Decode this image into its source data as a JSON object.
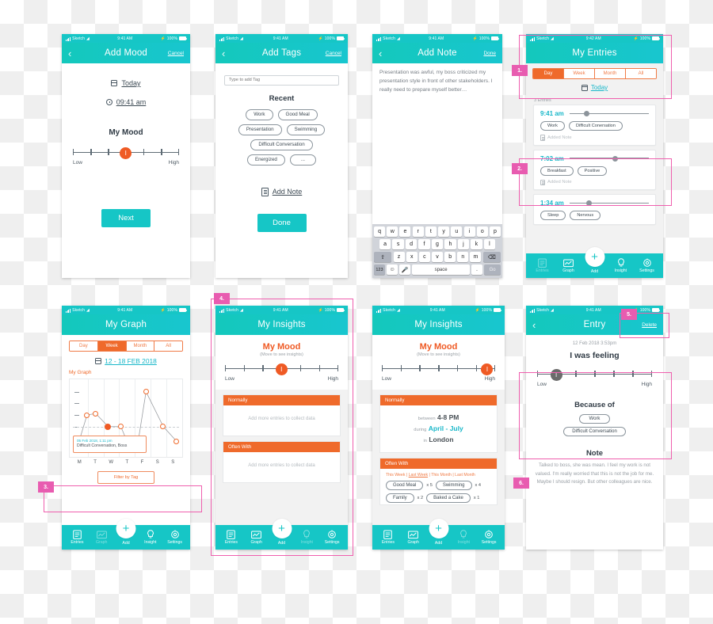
{
  "statusbar": {
    "carrier": "Sketch",
    "time_941": "9:41 AM",
    "time_942": "9:42 AM",
    "battery": "100%"
  },
  "tabbar": {
    "entries": "Entries",
    "graph": "Graph",
    "add": "Add",
    "insight": "Insight",
    "settings": "Settings"
  },
  "screens": {
    "add_mood": {
      "title": "Add Mood",
      "back": "‹",
      "cancel": "Cancel",
      "date": "Today",
      "time": "09:41 am",
      "mood_heading": "My Mood",
      "slider_low": "Low",
      "slider_high": "High",
      "thumb_label": "I",
      "next": "Next"
    },
    "add_tags": {
      "title": "Add Tags",
      "back": "‹",
      "cancel": "Cancel",
      "input_placeholder": "Type to add Tag",
      "recent_heading": "Recent",
      "tags_row1": [
        "Work",
        "Good Meal"
      ],
      "tags_row2": [
        "Presentation",
        "Swimming"
      ],
      "tags_row3": [
        "Difficult Conversation"
      ],
      "tags_row4": [
        "Energized",
        "..."
      ],
      "add_note": "Add Note",
      "done": "Done"
    },
    "add_note": {
      "title": "Add Note",
      "back": "‹",
      "done": "Done",
      "body": "Presentation was awful, my boss criticized my presentation style in front of other stakeholders. I really need to prepare myself better…",
      "keyboard": {
        "row1": [
          "q",
          "w",
          "e",
          "r",
          "t",
          "y",
          "u",
          "i",
          "o",
          "p"
        ],
        "row2": [
          "a",
          "s",
          "d",
          "f",
          "g",
          "h",
          "j",
          "k",
          "l"
        ],
        "row3": [
          "⇧",
          "z",
          "x",
          "c",
          "v",
          "b",
          "n",
          "m",
          "⌫"
        ],
        "row4": [
          "123",
          "☺",
          "Ἲ4",
          "space",
          ".",
          "Go"
        ],
        "numbers_key": "123",
        "space_key": "space",
        "period_key": ".",
        "go_key": "Go"
      }
    },
    "my_entries": {
      "title": "My Entries",
      "segments": [
        "Day",
        "Week",
        "Month",
        "All"
      ],
      "active_segment": "Day",
      "today": "Today",
      "count": "3 Entries",
      "entries": [
        {
          "time": "9:41 am",
          "mood": 22,
          "tags": [
            "Work",
            "Difficult Conersation"
          ],
          "note": "Added Note"
        },
        {
          "time": "7:02 am",
          "mood": 58,
          "tags": [
            "Breakfast",
            "Positive"
          ],
          "note": "Added Note"
        },
        {
          "time": "1:34 am",
          "mood": 25,
          "tags": [
            "Sleep",
            "Nervous"
          ],
          "note": ""
        }
      ]
    },
    "my_graph": {
      "title": "My Graph",
      "segments": [
        "Day",
        "Week",
        "Month",
        "All"
      ],
      "active_segment": "Week",
      "date_range": "12 - 18 FEB 2018",
      "section_title": "My Graph",
      "tooltip_date": "05 Feb 2018, 1:11 pm",
      "tooltip_body": "Difficult Conversation, Boss",
      "filter_button": "Filter by Tag"
    },
    "insights_empty": {
      "title": "My Insights",
      "mood_title": "My Mood",
      "mood_sub": "(Move to see insights)",
      "slider_low": "Low",
      "slider_high": "High",
      "thumb_label": "I",
      "normally_header": "Normally",
      "normally_empty": "Add more entries to collect data",
      "often_header": "Often With",
      "often_empty": "Add more entries to collect data"
    },
    "insights_data": {
      "title": "My Insights",
      "mood_title": "My Mood",
      "mood_sub": "(Move to see insights)",
      "slider_low": "Low",
      "slider_high": "High",
      "thumb_label": "I",
      "normally_header": "Normally",
      "normally_rows": [
        {
          "pre": "between",
          "value": "4-8 PM",
          "teal": false
        },
        {
          "pre": "during",
          "value": "April - July",
          "teal": true
        },
        {
          "pre": "in",
          "value": "London",
          "teal": false
        }
      ],
      "often_header": "Often With",
      "filters": [
        "This Week",
        "Last Week",
        "This Month",
        "Last Month"
      ],
      "active_filter": "Last Week",
      "often_tags": [
        {
          "label": "Good Meal",
          "count": "x 5"
        },
        {
          "label": "Swimming",
          "count": "x 4"
        },
        {
          "label": "Family",
          "count": "x 2"
        },
        {
          "label": "Baked a Cake",
          "count": "x 1"
        }
      ]
    },
    "entry_detail": {
      "title": "Entry",
      "back": "‹",
      "delete": "Delete",
      "date": "12 Feb 2018 3:53pm",
      "feeling_heading": "I was feeling",
      "slider_low": "Low",
      "slider_high": "High",
      "thumb_label": "I",
      "because_heading": "Because of",
      "tags": [
        "Work",
        "Difficult Conversation"
      ],
      "note_heading": "Note",
      "note_body": "Talked to boss, she was mean. I feel my work is not valued. I'm really worried that this is not the job for me. Maybe I should resign.  But other colleagues are nice."
    }
  },
  "annotations": [
    {
      "num": "1."
    },
    {
      "num": "2."
    },
    {
      "num": "3."
    },
    {
      "num": "4."
    },
    {
      "num": "5."
    },
    {
      "num": "6."
    }
  ],
  "chart_data": {
    "type": "line",
    "title": "My Graph",
    "categories": [
      "M",
      "T",
      "W",
      "T",
      "F",
      "S",
      "S"
    ],
    "xlabel": "",
    "ylabel": "",
    "ylim": [
      0,
      5
    ],
    "grid": true,
    "annotation_date": "05 Feb 2018, 1:11 pm",
    "annotation_text": "Difficult Conversation, Boss",
    "series": [
      {
        "name": "Mood",
        "points": [
          {
            "x": 0.0,
            "y": 1.0,
            "marker": "open"
          },
          {
            "x": 0.45,
            "y": 3.0,
            "marker": "open"
          },
          {
            "x": 0.95,
            "y": 3.1,
            "marker": "open"
          },
          {
            "x": 1.75,
            "y": 2.2,
            "marker": "filled"
          },
          {
            "x": 2.6,
            "y": 2.2,
            "marker": "open"
          },
          {
            "x": 3.3,
            "y": 0.4,
            "marker": "square"
          },
          {
            "x": 3.95,
            "y": 1.3,
            "marker": "open"
          },
          {
            "x": 4.5,
            "y": 4.2,
            "marker": "open"
          },
          {
            "x": 5.5,
            "y": 2.2,
            "marker": "open"
          },
          {
            "x": 6.4,
            "y": 1.3,
            "marker": "open"
          }
        ]
      }
    ]
  }
}
